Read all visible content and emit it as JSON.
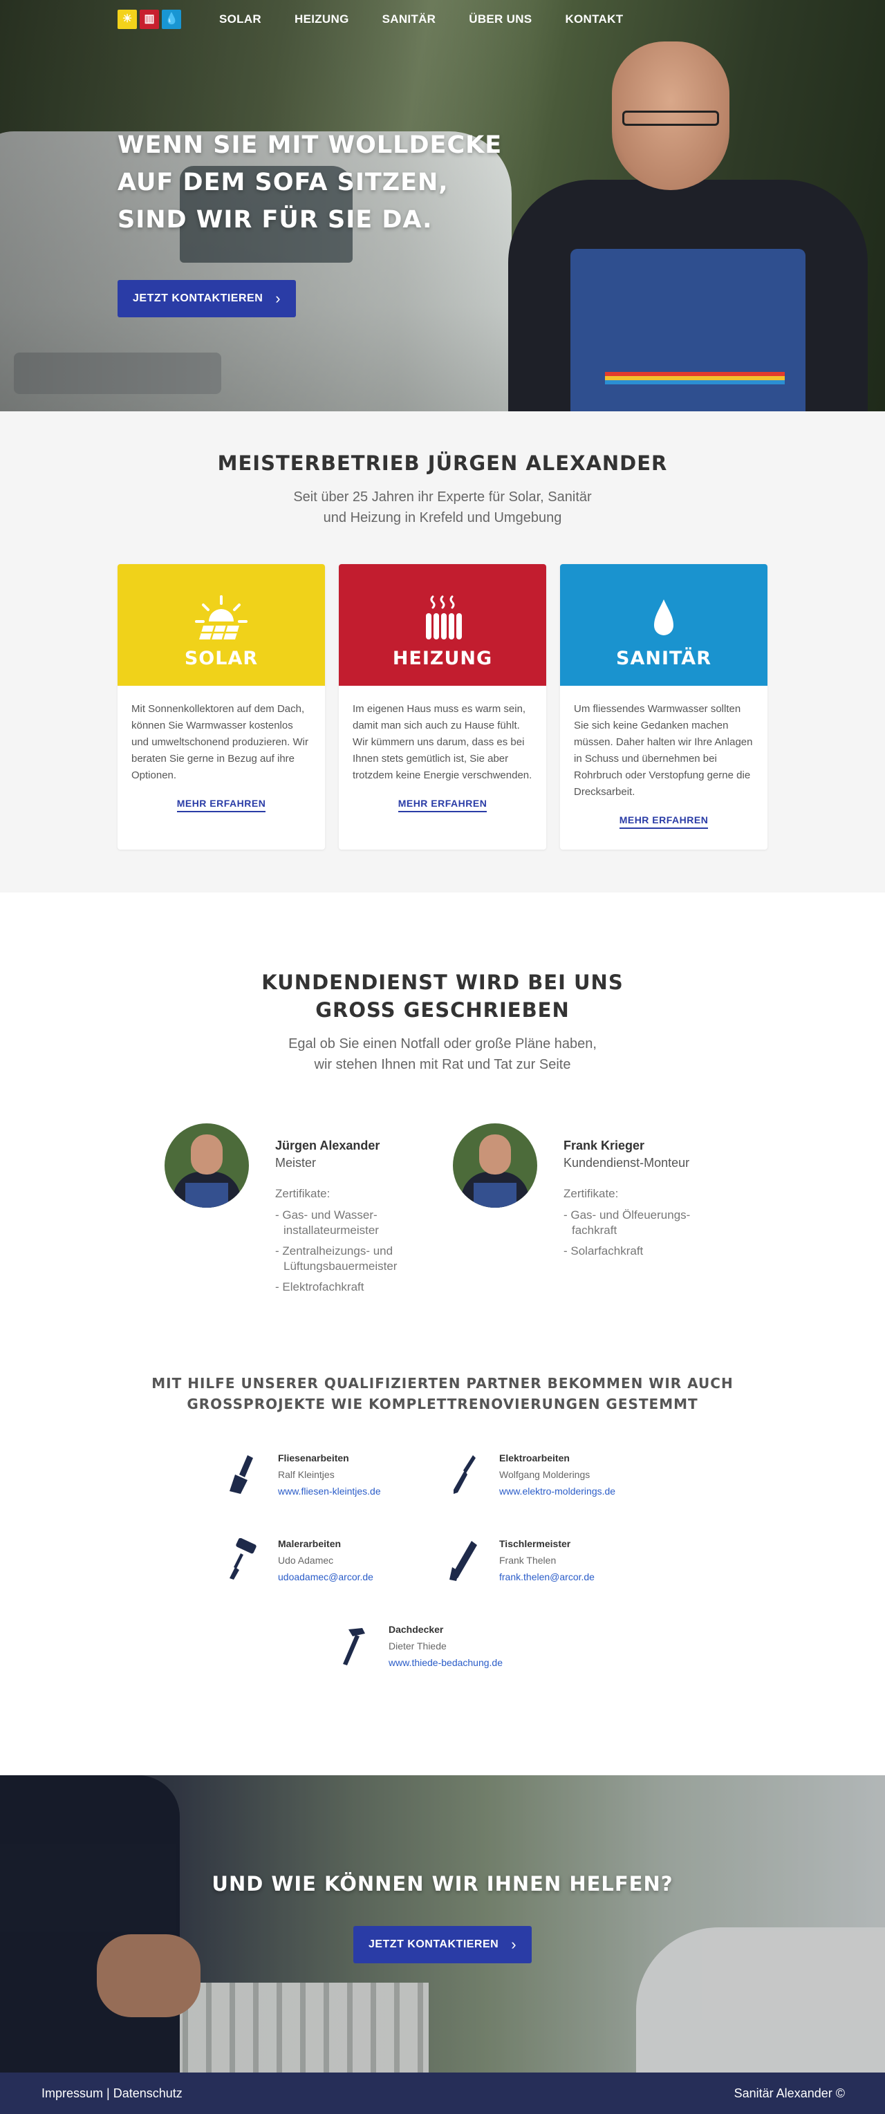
{
  "nav": {
    "logo_icons": [
      "solar-icon",
      "heizung-icon",
      "sanitaer-icon"
    ],
    "items": [
      {
        "label": "SOLAR"
      },
      {
        "label": "HEIZUNG"
      },
      {
        "label": "SANITÄR"
      },
      {
        "label": "ÜBER UNS"
      },
      {
        "label": "KONTAKT"
      }
    ]
  },
  "hero": {
    "headline_lines": [
      "WENN SIE MIT WOLLDECKE",
      "AUF DEM SOFA SITZEN,",
      "SIND WIR FÜR SIE DA."
    ],
    "cta_label": "JETZT KONTAKTIEREN"
  },
  "services": {
    "title": "MEISTERBETRIEB JÜRGEN ALEXANDER",
    "subtitle_lines": [
      "Seit über 25 Jahren ihr Experte für Solar, Sanitär",
      "und Heizung in Krefeld und Umgebung"
    ],
    "cards": [
      {
        "title": "SOLAR",
        "icon": "sun-panel-icon",
        "text": "Mit Sonnenkollektoren auf dem Dach, können Sie Warmwasser kostenlos und umweltschonend produzieren. Wir beraten Sie gerne in Bezug auf ihre Optionen.",
        "link": "MEHR ERFAHREN"
      },
      {
        "title": "HEIZUNG",
        "icon": "radiator-icon",
        "text": "Im eigenen Haus muss es warm sein, damit man sich auch zu Hause fühlt. Wir kümmern uns darum, dass es bei Ihnen stets gemütlich ist, Sie aber trotzdem keine Energie verschwenden.",
        "link": "MEHR ERFAHREN"
      },
      {
        "title": "SANITÄR",
        "icon": "water-drop-icon",
        "text": "Um fliessendes Warmwasser sollten Sie sich keine Gedanken machen müssen. Daher halten wir Ihre Anlagen in Schuss und übernehmen bei Rohrbruch oder Verstopfung gerne die Drecksarbeit.",
        "link": "MEHR ERFAHREN"
      }
    ],
    "colors": {
      "solar": "#f0d21a",
      "heizung": "#c21d2f",
      "sanitaer": "#1a93cf"
    }
  },
  "kundendienst": {
    "title_lines": [
      "KUNDENDIENST WIRD BEI UNS",
      "GROSS GESCHRIEBEN"
    ],
    "subtitle_lines": [
      "Egal ob Sie einen Notfall oder große Pläne haben,",
      "wir stehen Ihnen mit Rat und Tat zur Seite"
    ],
    "members": [
      {
        "name": "Jürgen Alexander",
        "role": "Meister",
        "cert_label": "Zertifikate:",
        "certs": [
          "- Gas- und Wasser- installateurmeister",
          "- Zentralheizungs- und Lüftungsbauermeister",
          "- Elektrofachkraft"
        ]
      },
      {
        "name": "Frank Krieger",
        "role": "Kundendienst-Monteur",
        "cert_label": "Zertifikate:",
        "certs": [
          "- Gas- und Ölfeuerungs- fachkraft",
          "- Solarfachkraft"
        ]
      }
    ]
  },
  "partners": {
    "title_lines": [
      "MIT HILFE UNSERER QUALIFIZIERTEN PARTNER BEKOMMEN WIR AUCH",
      "GROSSPROJEKTE WIE KOMPLETTRENOVIERUNGEN GESTEMMT"
    ],
    "items": [
      {
        "trade": "Fliesenarbeiten",
        "person": "Ralf Kleintjes",
        "link": "www.fliesen-kleintjes.de",
        "icon": "trowel-icon"
      },
      {
        "trade": "Elektroarbeiten",
        "person": "Wolfgang Molderings",
        "link": "www.elektro-molderings.de",
        "icon": "screwdriver-icon"
      },
      {
        "trade": "Malerarbeiten",
        "person": "Udo Adamec",
        "link": "udoadamec@arcor.de",
        "icon": "paint-roller-icon"
      },
      {
        "trade": "Tischlermeister",
        "person": "Frank Thelen",
        "link": "frank.thelen@arcor.de",
        "icon": "saw-icon"
      },
      {
        "trade": "Dachdecker",
        "person": "Dieter Thiede",
        "link": "www.thiede-bedachung.de",
        "icon": "hammer-icon"
      }
    ]
  },
  "cta": {
    "title": "UND WIE KÖNNEN WIR IHNEN HELFEN?",
    "button_label": "JETZT KONTAKTIEREN"
  },
  "footer": {
    "impressum": "Impressum",
    "separator": "|",
    "datenschutz": "Datenschutz",
    "copyright": "Sanitär Alexander ©"
  }
}
